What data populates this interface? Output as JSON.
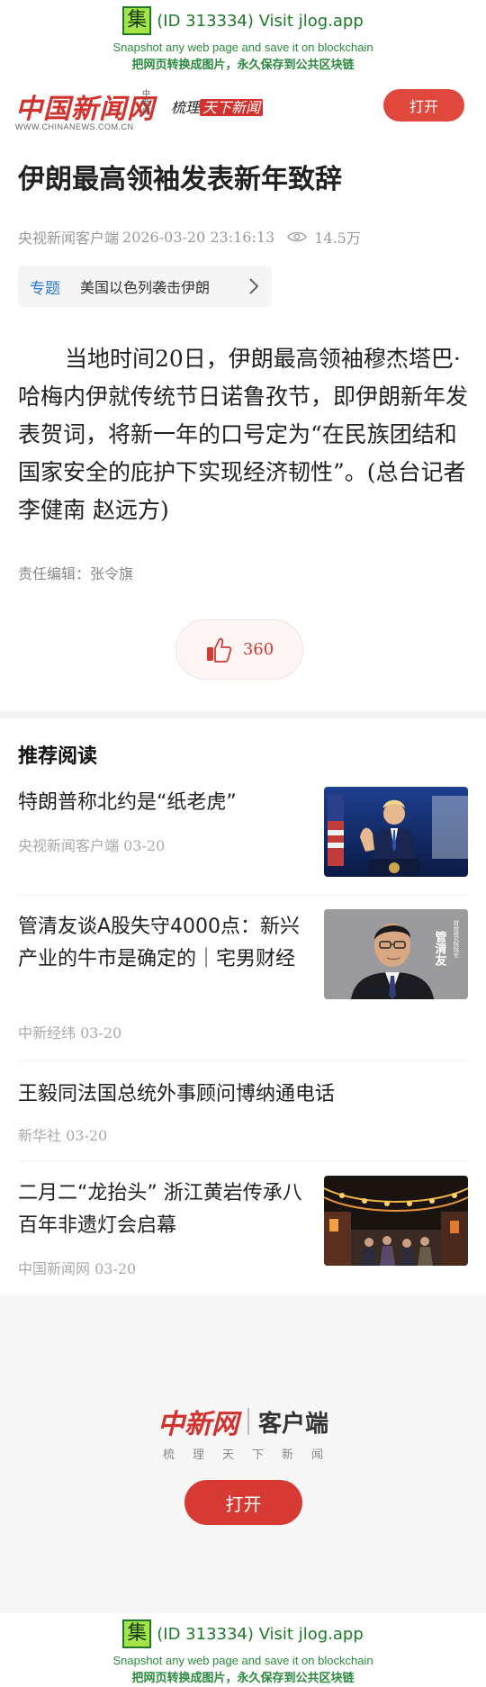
{
  "jlog": {
    "icon_char": "集",
    "line1": "(ID 313334) Visit jlog.app",
    "line2": "Snapshot any web page and save it on blockchain",
    "line3": "把网页转换成图片，永久保存到公共区块链"
  },
  "header": {
    "logo_text": "中国新闻网",
    "logo_sub": "中新网",
    "logo_url": "WWW.CHINANEWS.COM.CN",
    "slogan_part1": "梳理",
    "slogan_part2": "天下新闻",
    "open_label": "打开"
  },
  "article": {
    "title": "伊朗最高领袖发表新年致辞",
    "source": "央视新闻客户端",
    "datetime": "2026-03-20 23:16:13",
    "views": "14.5万",
    "topic_tag": "专题",
    "topic_text": "美国以色列袭击伊朗",
    "body": "当地时间20日，伊朗最高领袖穆杰塔巴·哈梅内伊就传统节日诺鲁孜节，即伊朗新年发表贺词，将新一年的口号定为“在民族团结和国家安全的庇护下实现经济韧性”。(总台记者 李健南 赵远方)",
    "editor": "责任编辑：张令旗",
    "likes": "360"
  },
  "recommend": {
    "heading": "推荐阅读",
    "items": [
      {
        "title": "特朗普称北约是“纸老虎”",
        "meta": "央视新闻客户端 03-20"
      },
      {
        "title": "管清友谈A股失守4000点：新兴产业的牛市是确定的｜宅男财经",
        "meta": "中新经纬 03-20"
      },
      {
        "title": "王毅同法国总统外事顾问博纳通电话",
        "meta": "新华社 03-20"
      },
      {
        "title": "二月二“龙抬头” 浙江黄岩传承八百年非遗灯会启幕",
        "meta": "中国新闻网 03-20"
      }
    ],
    "thumb2_caption": "管清友"
  },
  "promo": {
    "logo_text": "中新网",
    "client_label": "客户端",
    "slogan": "梳理天下新闻",
    "open_label": "打开"
  },
  "colors": {
    "brand_red": "#d2322d",
    "jlog_green": "#1e7a2a",
    "topic_blue": "#2a7ad1"
  }
}
